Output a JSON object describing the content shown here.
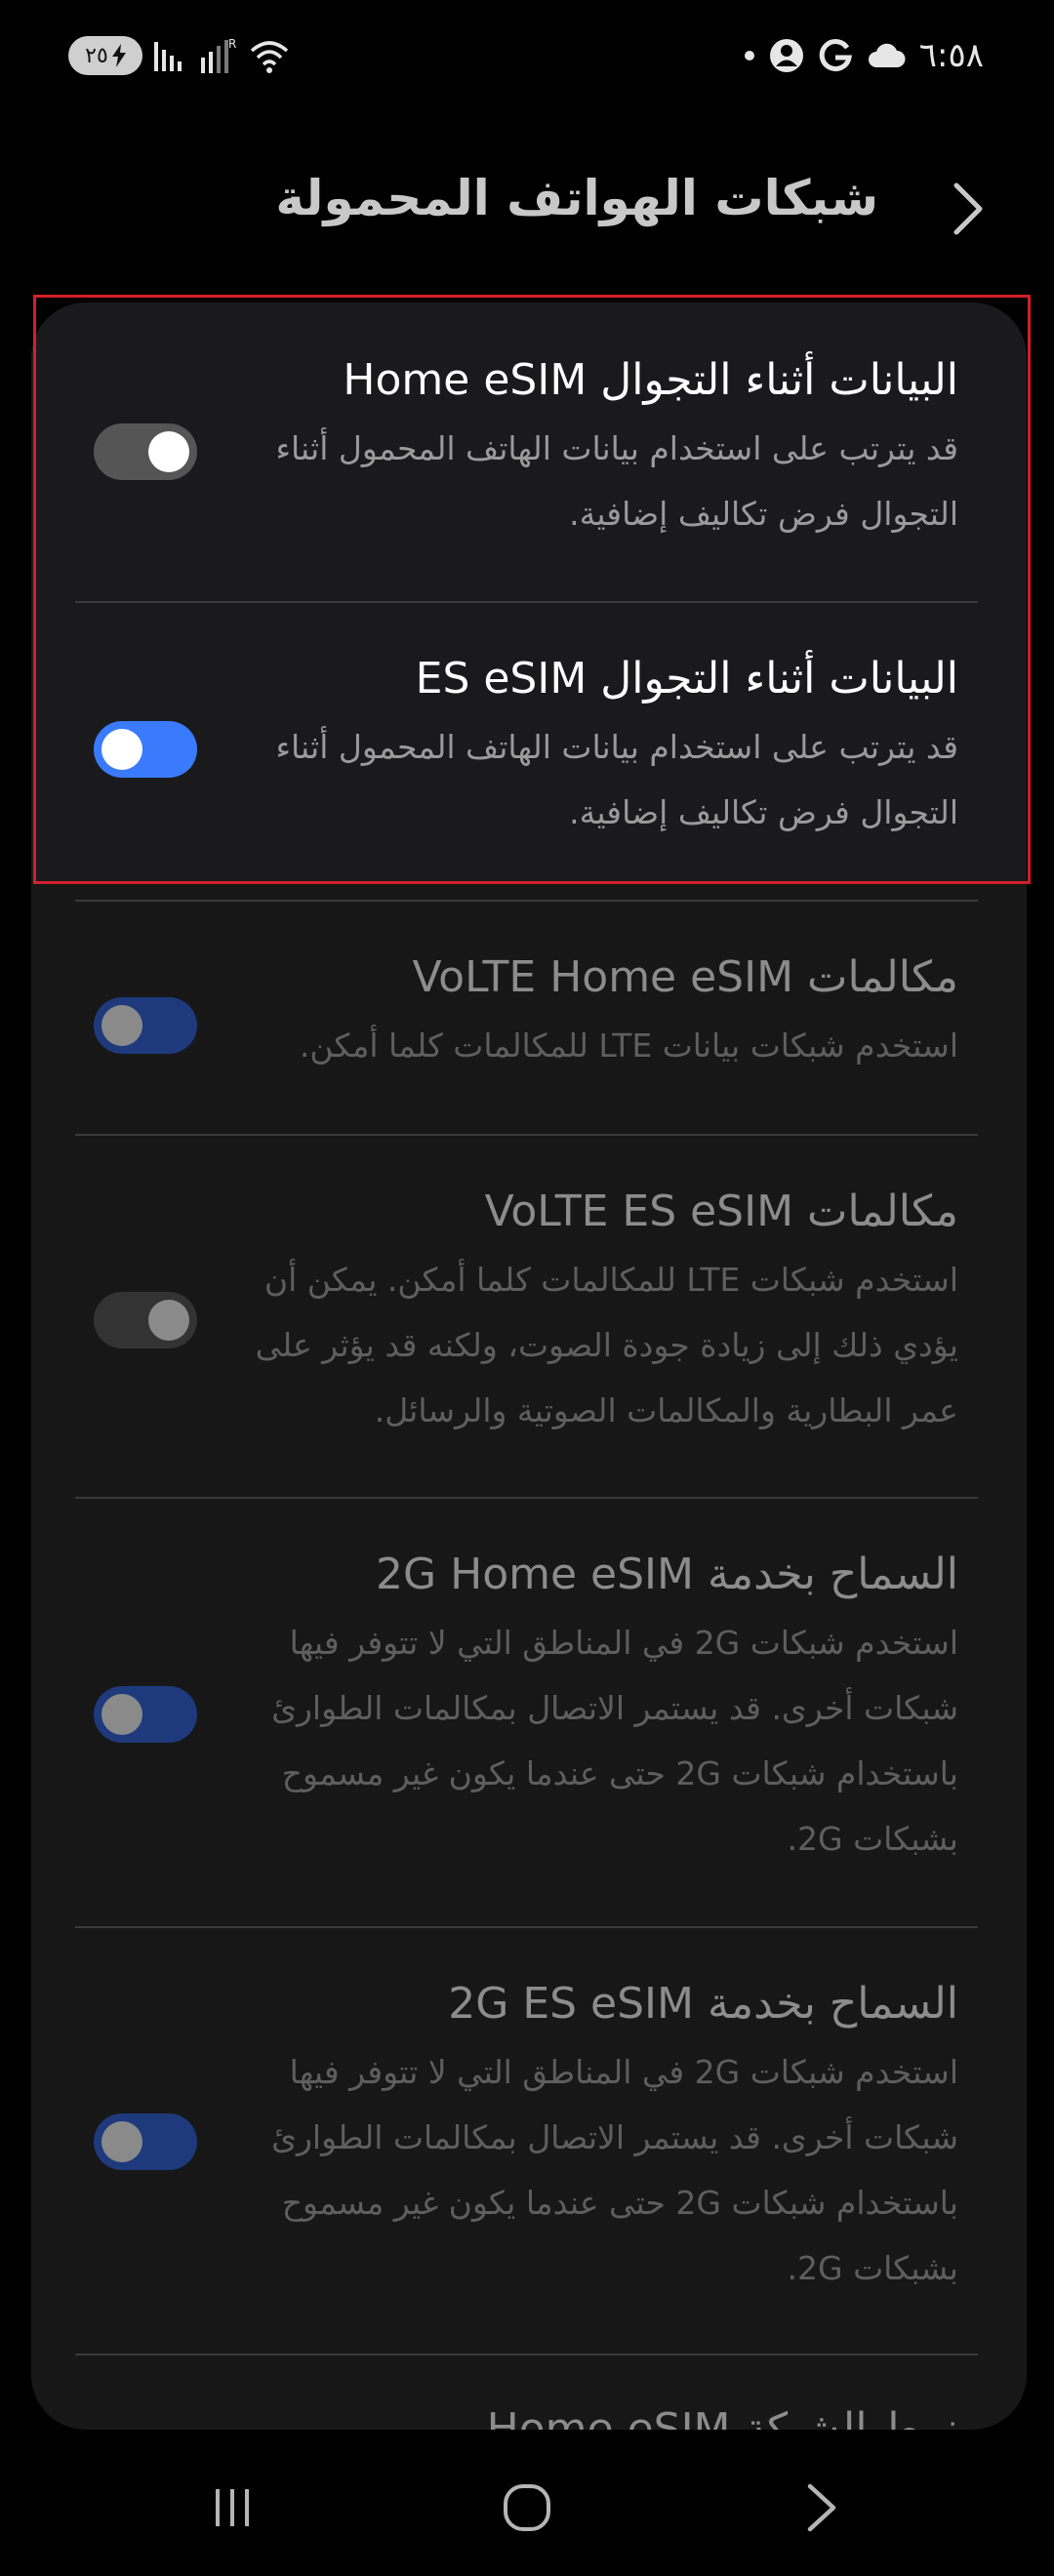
{
  "status_bar": {
    "time": "٦:٥٨",
    "battery_level": "٢٥",
    "icons": [
      "cloud-icon",
      "g-icon",
      "account-icon",
      "dot-icon",
      "wifi-icon",
      "signal-r-icon",
      "signal-icon",
      "charging-icon"
    ]
  },
  "header": {
    "title": "شبكات الهواتف المحمولة",
    "back_icon": "chevron-right-icon"
  },
  "settings": [
    {
      "title": "البيانات أثناء التجوال Home eSIM",
      "subtitle_lines": [
        "قد يترتب على استخدام بيانات الهاتف المحمول أثناء",
        "التجوال فرض تكاليف إضافية."
      ],
      "toggle": "off"
    },
    {
      "title": "البيانات أثناء التجوال ES eSIM",
      "subtitle_lines": [
        "قد يترتب على استخدام بيانات الهاتف المحمول أثناء",
        "التجوال فرض تكاليف إضافية."
      ],
      "toggle": "on"
    },
    {
      "title": "مكالمات VoLTE Home eSIM",
      "subtitle_lines": [
        "استخدم شبكات بيانات LTE للمكالمات كلما أمكن."
      ],
      "toggle": "on"
    },
    {
      "title": "مكالمات VoLTE ES eSIM",
      "subtitle_lines": [
        "استخدم شبكات LTE للمكالمات كلما أمكن. يمكن أن",
        "يؤدي ذلك إلى زيادة جودة الصوت، ولكنه قد يؤثر على",
        "عمر البطارية والمكالمات الصوتية والرسائل."
      ],
      "toggle": "off"
    },
    {
      "title": "السماح بخدمة 2G Home eSIM",
      "subtitle_lines": [
        "استخدم شبكات 2G في المناطق التي لا تتوفر فيها",
        "شبكات أخرى. قد يستمر الاتصال بمكالمات الطوارئ",
        "باستخدام شبكات 2G حتى عندما يكون غير مسموح",
        "بشبكات 2G."
      ],
      "toggle": "on"
    },
    {
      "title": "السماح بخدمة 2G ES eSIM",
      "subtitle_lines": [
        "استخدم شبكات 2G في المناطق التي لا تتوفر فيها",
        "شبكات أخرى. قد يستمر الاتصال بمكالمات الطوارئ",
        "باستخدام شبكات 2G حتى عندما يكون غير مسموح",
        "بشبكات 2G."
      ],
      "toggle": "on"
    },
    {
      "title": "نمط الشبكة Home eSIM",
      "subtitle_lines": [],
      "toggle": "none"
    }
  ],
  "nav_bar": {
    "items": [
      "recents-icon",
      "home-icon",
      "back-icon"
    ]
  },
  "colors": {
    "background": "#010101",
    "card": "#171717",
    "toggle_on_track": "#3a7bfd",
    "toggle_off_track": "#555555",
    "toggle_dim_on_track": "#1e3a7c",
    "toggle_dim_off_track": "#333333",
    "highlight_frame": "#d2202a"
  }
}
